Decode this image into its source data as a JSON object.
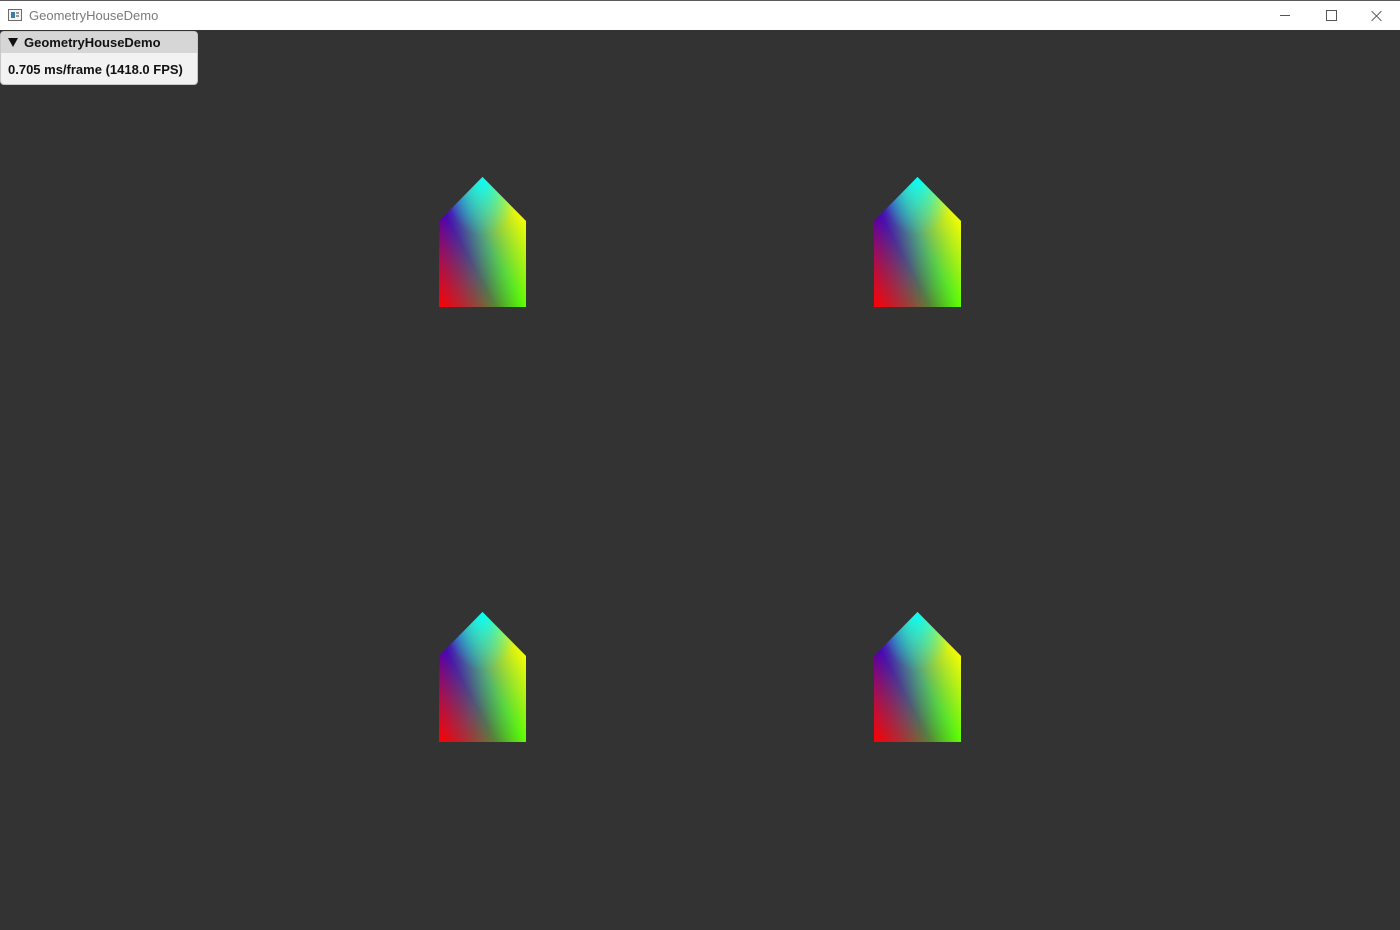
{
  "window": {
    "title": "GeometryHouseDemo",
    "background_color": "#333333",
    "icon": "app-window-icon",
    "controls": {
      "minimize_icon": "minimize-icon",
      "maximize_icon": "maximize-icon",
      "close_icon": "close-icon"
    }
  },
  "overlay": {
    "title": "GeometryHouseDemo",
    "collapse_icon": "triangle-down-icon",
    "stats": "0.705 ms/frame (1418.0 FPS)"
  },
  "scene": {
    "house_count": 4,
    "vertex_colors": {
      "roof_top": "#00ffff",
      "upper_left": "#0000ff",
      "upper_right": "#ffff00",
      "lower_left": "#ff0000",
      "lower_right": "#00ff00"
    }
  }
}
